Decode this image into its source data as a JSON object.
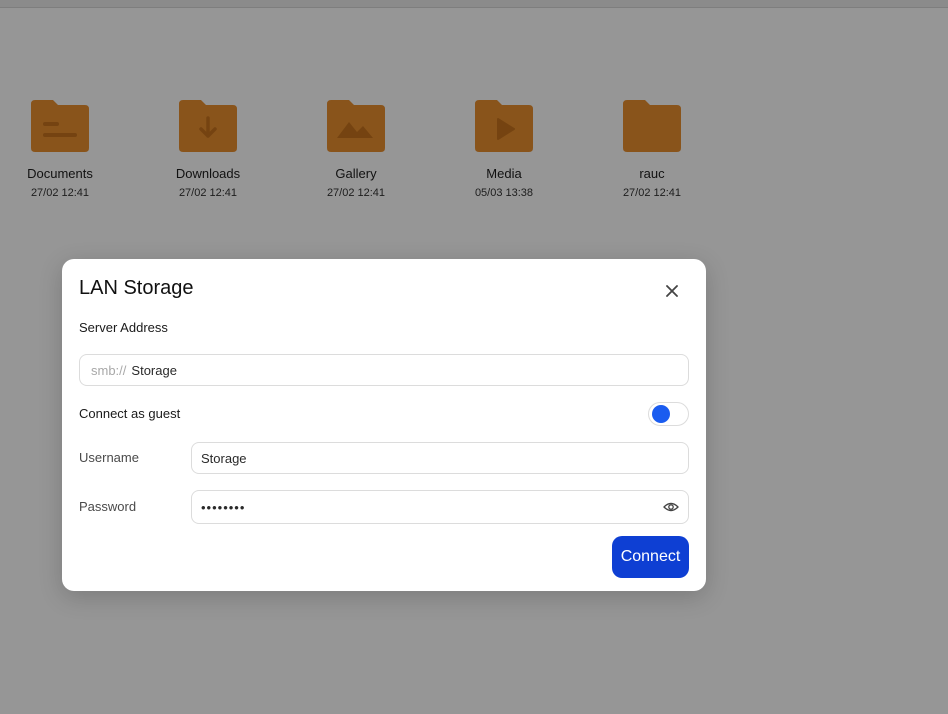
{
  "colors": {
    "folder": "#e9902f",
    "folder_detail": "#c7731d",
    "accent": "#1a5cf0",
    "connect_button": "#0e3fd3"
  },
  "files": [
    {
      "name": "Documents",
      "date": "27/02 12:41",
      "icon": "document-folder-icon"
    },
    {
      "name": "Downloads",
      "date": "27/02 12:41",
      "icon": "download-folder-icon"
    },
    {
      "name": "Gallery",
      "date": "27/02 12:41",
      "icon": "image-folder-icon"
    },
    {
      "name": "Media",
      "date": "05/03 13:38",
      "icon": "media-folder-icon"
    },
    {
      "name": "rauc",
      "date": "27/02 12:41",
      "icon": "folder-icon"
    }
  ],
  "dialog": {
    "title": "LAN Storage",
    "close_icon": "close-icon",
    "server_address_label": "Server Address",
    "server_prefix": "smb://",
    "server_value": "Storage",
    "guest_label": "Connect as guest",
    "guest_toggle_on": true,
    "username_label": "Username",
    "username_value": "Storage",
    "password_label": "Password",
    "password_value": "••••••••",
    "eye_icon": "eye-icon",
    "connect_label": "Connect"
  }
}
